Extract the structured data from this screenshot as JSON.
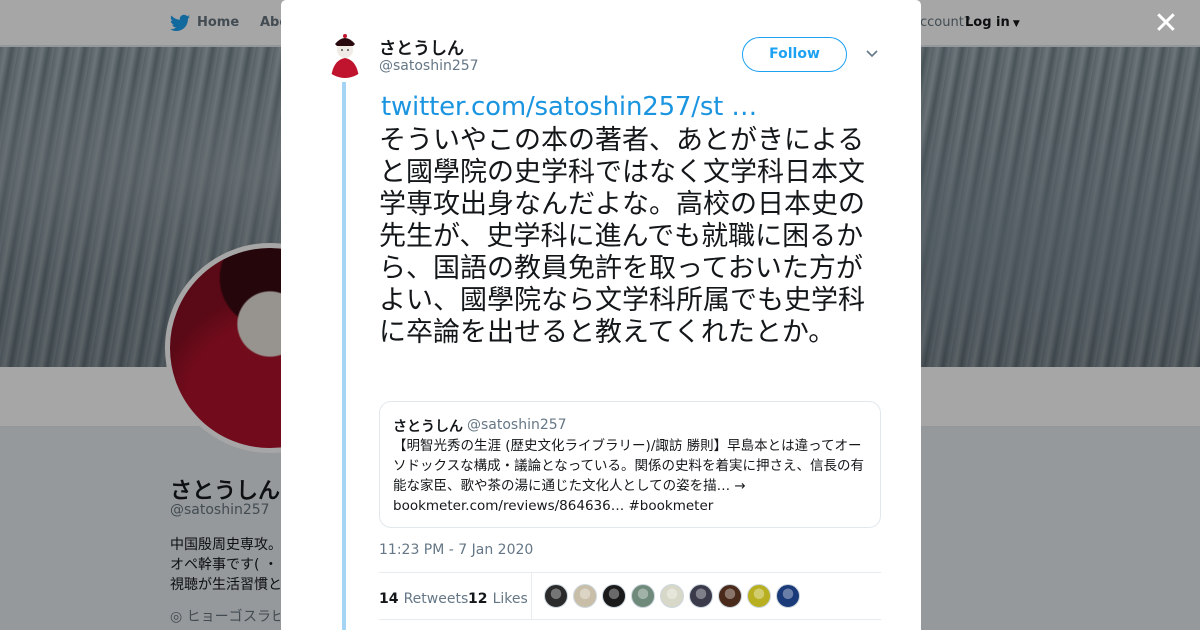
{
  "nav": {
    "home": "Home",
    "about": "Abo",
    "account": "ccount?",
    "login": "Log in"
  },
  "profile": {
    "name": "さとうしん",
    "handle": "@satoshin257",
    "bio": "中国殷周史専攻。\nオペ幹事です( ・\n視聴が生活習慣と",
    "location": "ヒョーゴスラビ"
  },
  "tweet": {
    "author_name": "さとうしん",
    "author_handle": "@satoshin257",
    "follow_label": "Follow",
    "link": "twitter.com/satoshin257/st …",
    "text": "そういやこの本の著者、あとがきによると國學院の史学科ではなく文学科日本文学専攻出身なんだよな。高校の日本史の先生が、史学科に進んでも就職に困るから、国語の教員免許を取っておいた方がよい、國學院なら文学科所属でも史学科に卒論を出せると教えてくれたとか。",
    "timestamp": "11:23 PM - 7 Jan 2020",
    "retweets": "14",
    "retweets_label": "Retweets",
    "likes": "12",
    "likes_label": "Likes"
  },
  "quote": {
    "name": "さとうしん",
    "handle": "@satoshin257",
    "text": "【明智光秀の生涯 (歴史文化ライブラリー)/諏訪 勝則】早島本とは違ってオーソドックスな構成・議論となっている。関係の史料を着実に押さえ、信長の有能な家臣、歌や茶の湯に通じた文化人としての姿を描… → bookmeter.com/reviews/864636… #bookmeter"
  },
  "likers": [
    "#2b2b2b",
    "#c9bfa8",
    "#1a1a1a",
    "#6f8a7a",
    "#d8d8c8",
    "#3a3a4a",
    "#4a2a1a",
    "#b8b020",
    "#1a3a7a"
  ],
  "colors": {
    "accent": "#1da1f2",
    "link": "#1b95e0",
    "thread": "#a4d5f5"
  },
  "icons": {
    "nav_logo": "twitter-bird-icon",
    "close": "close-icon",
    "caret": "chevron-down-icon",
    "location": "location-pin-icon"
  }
}
